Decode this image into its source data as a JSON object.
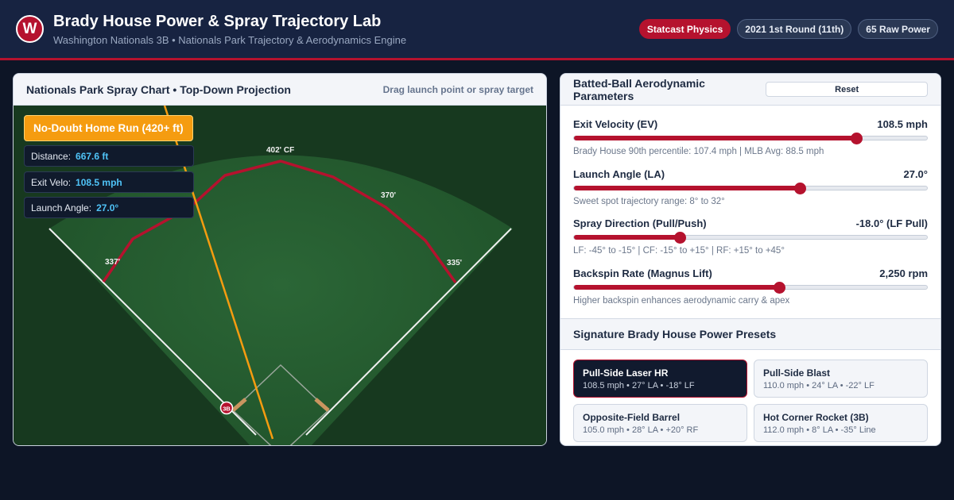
{
  "header": {
    "logo_letter": "W",
    "title": "Brady House Power & Spray Trajectory Lab",
    "subtitle": "Washington Nationals 3B • Nationals Park Trajectory & Aerodynamics Engine",
    "badges": [
      "Statcast Physics",
      "2021 1st Round (11th)",
      "65 Raw Power"
    ]
  },
  "spray_chart": {
    "title": "Nationals Park Spray Chart • Top-Down Projection",
    "hint": "Drag launch point or spray target",
    "result_label": "No-Doubt Home Run (420+ ft)",
    "stats": [
      {
        "label": "Distance:",
        "value": "667.6 ft"
      },
      {
        "label": "Exit Velo:",
        "value": "108.5 mph"
      },
      {
        "label": "Launch Angle:",
        "value": "27.0°"
      }
    ],
    "wall_labels": {
      "lf": "337'",
      "lcf": "",
      "cf": "402' CF",
      "rcf": "370'",
      "rf": "335'"
    },
    "batter_marker": "3B"
  },
  "parameters": {
    "title": "Batted-Ball Aerodynamic Parameters",
    "reset_label": "Reset",
    "items": [
      {
        "label": "Exit Velocity (EV)",
        "value": "108.5 mph",
        "fraction": 0.8,
        "note": "Brady House 90th percentile: 107.4 mph | MLB Avg: 88.5 mph"
      },
      {
        "label": "Launch Angle (LA)",
        "value": "27.0°",
        "fraction": 0.64,
        "note": "Sweet spot trajectory range: 8° to 32°"
      },
      {
        "label": "Spray Direction (Pull/Push)",
        "value": "-18.0° (LF Pull)",
        "fraction": 0.3,
        "note": "LF: -45° to -15° | CF: -15° to +15° | RF: +15° to +45°"
      },
      {
        "label": "Backspin Rate (Magnus Lift)",
        "value": "2,250 rpm",
        "fraction": 0.58,
        "note": "Higher backspin enhances aerodynamic carry & apex"
      }
    ]
  },
  "presets": {
    "title": "Signature Brady House Power Presets",
    "items": [
      {
        "name": "Pull-Side Laser HR",
        "detail": "108.5 mph • 27° LA • -18° LF",
        "active": true
      },
      {
        "name": "Pull-Side Blast",
        "detail": "110.0 mph • 24° LA • -22° LF",
        "active": false
      },
      {
        "name": "Opposite-Field Barrel",
        "detail": "105.0 mph • 28° LA • +20° RF",
        "active": false
      },
      {
        "name": "Hot Corner Rocket (3B)",
        "detail": "112.0 mph • 8° LA • -35° Line",
        "active": false
      }
    ]
  },
  "colors": {
    "accent": "#b5122e",
    "header_bg": "#172341",
    "trajectory": "#f59c10",
    "grass": "#245a2e"
  }
}
